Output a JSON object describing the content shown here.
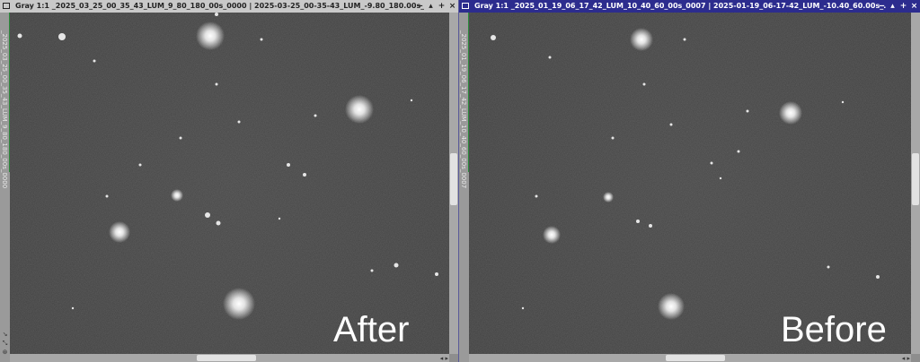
{
  "left_window": {
    "title": "Gray 1:1 _2025_03_25_00_35_43_LUM_9_80_180_00s_0000 | 2025-03-25_00-35-43_LUM_-9.80_180.00s_...",
    "side_label": "_2025_03_25_00_35_43_LUM_9_80_180_00s_0000",
    "caption": "After"
  },
  "right_window": {
    "title": "Gray 1:1 _2025_01_19_06_17_42_LUM_10_40_60_00s_0007 | 2025-01-19_06-17-42_LUM_-10.40_60.00s_...",
    "side_label": "_2025_01_19_06_17_42_LUM_10_40_60_00s_0007",
    "caption": "Before"
  },
  "titlebar_buttons": {
    "minimize": "‒",
    "shade": "▴",
    "maximize": "+",
    "close": "×"
  },
  "tool_icons": [
    "↘",
    "⤡",
    "⊛"
  ],
  "scroll_arrows": "◂ ▸",
  "colors": {
    "active_title": "#2c2c8e",
    "inactive_title": "#c9c9c9",
    "sky": "#3a3a3a",
    "side_accent": "#2a8a3a"
  }
}
